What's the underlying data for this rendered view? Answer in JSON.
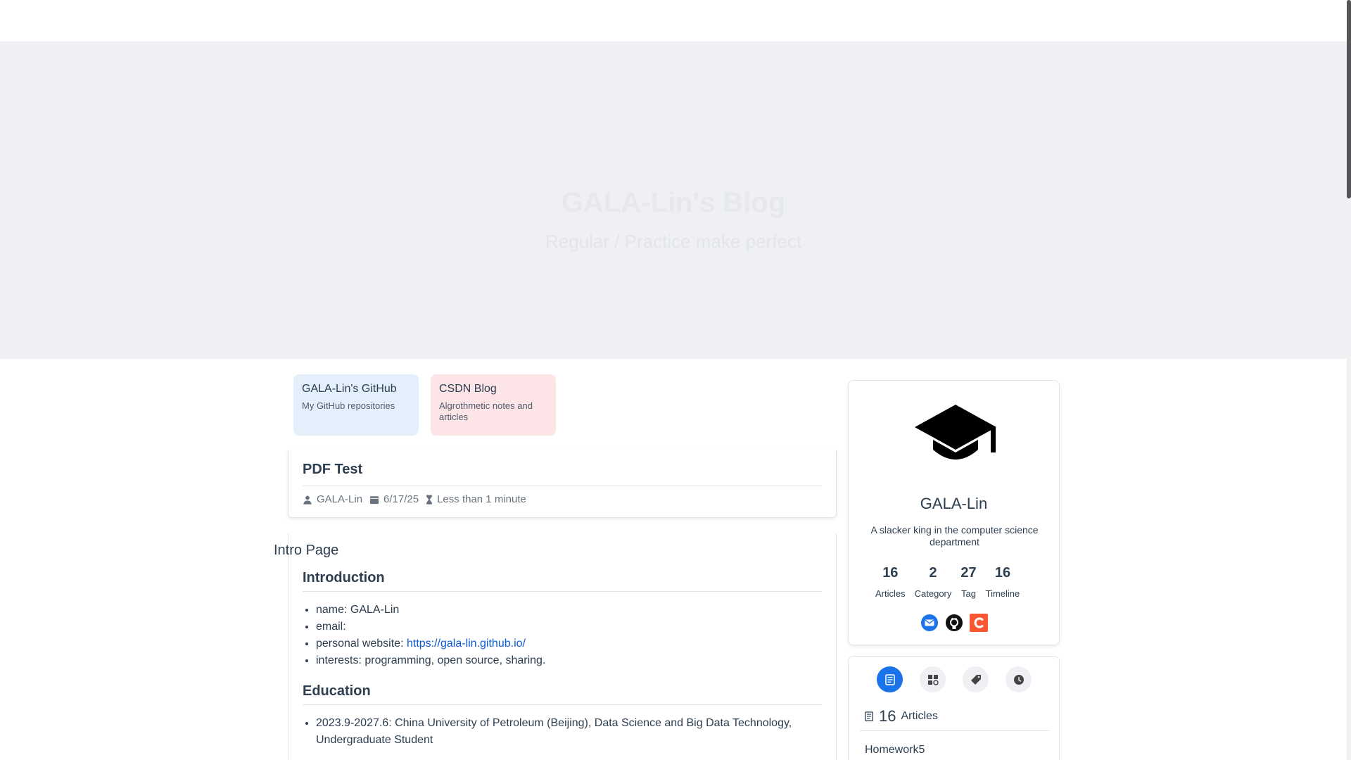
{
  "hero": {
    "title": "GALA-Lin's Blog",
    "tagline": "Regular / Practice make perfect"
  },
  "projects": [
    {
      "name": "GALA-Lin's GitHub",
      "desc": "My GitHub repositories"
    },
    {
      "name": "CSDN Blog",
      "desc": "Algrothmetic notes and articles"
    }
  ],
  "post": {
    "title": "PDF Test",
    "author": "GALA-Lin",
    "date": "6/17/25",
    "reading_time": "Less than 1 minute"
  },
  "intro_label": "Intro Page",
  "content": {
    "intro_heading": "Introduction",
    "name_item": "name: GALA-Lin",
    "email_item": "email:",
    "website_prefix": "personal website: ",
    "website_link": "https://gala-lin.github.io/",
    "interests_item": "interests: programming, open source, sharing.",
    "edu_heading": "Education",
    "edu_item": "2023.9-2027.6: China University of Petroleum (Beijing), Data Science and Big Data Technology, Undergraduate Student"
  },
  "profile": {
    "avatar_icon": "graduation-cap-icon",
    "name": "GALA-Lin",
    "desc": "A slacker king in the computer science department",
    "stats": [
      {
        "num": "16",
        "label": "Articles"
      },
      {
        "num": "2",
        "label": "Category"
      },
      {
        "num": "27",
        "label": "Tag"
      },
      {
        "num": "16",
        "label": "Timeline"
      }
    ],
    "social": [
      "email-icon",
      "github-icon",
      "csdn-icon"
    ]
  },
  "archive": {
    "tabs": [
      "article-icon",
      "category-icon",
      "tag-icon",
      "timeline-icon"
    ],
    "count": "16",
    "count_label": "Articles",
    "first_item": "Homework5"
  },
  "colors": {
    "accent": "#1a73e8",
    "link": "#0a5ad4",
    "csdn": "#fc5531",
    "github_card_bg": "#e4effc",
    "csdn_card_bg": "#fde4e7"
  }
}
